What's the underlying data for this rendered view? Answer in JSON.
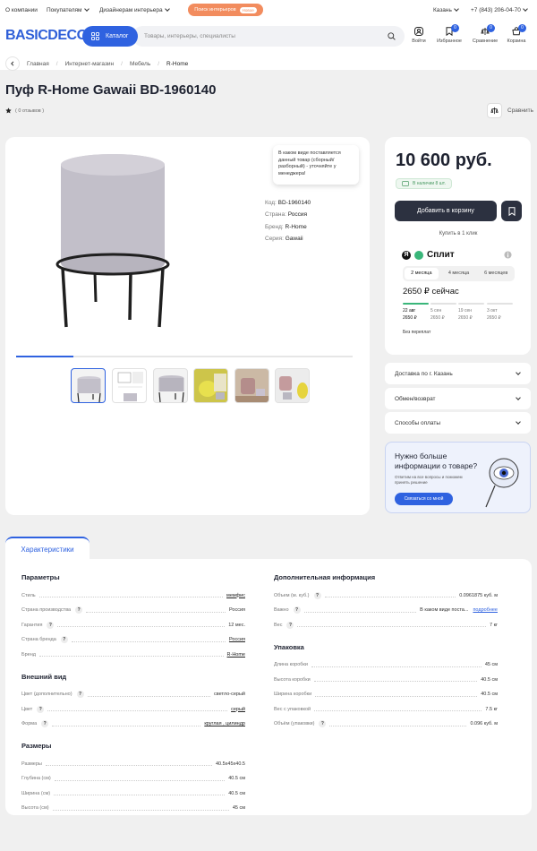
{
  "topbar": {
    "links": [
      "О компании",
      "Покупателям",
      "Дизайнерам интерьера"
    ],
    "promo_pill": {
      "label": "Поиск интерьеров",
      "badge": "Новое"
    },
    "city": "Казань",
    "phone": "+7 (843) 206-04-70"
  },
  "header": {
    "logo": "BASICDECOR",
    "catalog_label": "Каталог",
    "search_placeholder": "Товары, интерьеры, специалисты",
    "icons": [
      {
        "label": "Войти",
        "icon": "user-icon",
        "count": ""
      },
      {
        "label": "Избранное",
        "icon": "bookmark-icon",
        "count": "0"
      },
      {
        "label": "Сравнение",
        "icon": "compare-icon",
        "count": "0"
      },
      {
        "label": "Корзина",
        "icon": "cart-icon",
        "count": "0"
      }
    ]
  },
  "breadcrumbs": [
    "Главная",
    "Интернет-магазин",
    "Мебель",
    "R-Home"
  ],
  "product": {
    "title": "Пуф R-Home Gawaii BD-1960140",
    "rating_text": "( 0 отзывов )",
    "compare_label": "Сравнить",
    "tooltip": "В каком виде поставляется данный товар (сборный/разборный) - уточняйте у менеджера!",
    "specs": [
      {
        "label": "Код:",
        "value": "BD-1960140"
      },
      {
        "label": "Страна:",
        "value": "Россия"
      },
      {
        "label": "Бренд:",
        "value": "R-Home"
      },
      {
        "label": "Серия:",
        "value": "Gawaii"
      }
    ],
    "gallery_progress": 0.17
  },
  "buy": {
    "price": "10 600 руб.",
    "stock": "В наличии 8 шт.",
    "cart_button": "Добавить в корзину",
    "one_click": "Купить в 1 клик",
    "split": {
      "brand": "Сплит",
      "tabs": [
        "2 месяца",
        "4 месяца",
        "6 месяцев"
      ],
      "now": "2650 ₽ сейчас",
      "schedule": [
        {
          "date": "22 авг",
          "amount": "2650 ₽"
        },
        {
          "date": "5 сен",
          "amount": "2650 ₽"
        },
        {
          "date": "19 сен",
          "amount": "2650 ₽"
        },
        {
          "date": "3 окт",
          "amount": "2650 ₽"
        }
      ],
      "note": "Без переплат"
    },
    "accordions": [
      "Доставка по г. Казань",
      "Обмен/возврат",
      "Способы оплаты"
    ]
  },
  "promo": {
    "heading": "Нужно больше информации о товаре?",
    "sub": "Ответим на все вопросы и поможем принять решение",
    "button": "Связаться со мной"
  },
  "characteristics": {
    "tab": "Характеристики",
    "left": [
      {
        "title": "Параметры",
        "rows": [
          {
            "label": "Стиль",
            "value": "мемфис",
            "link": true,
            "help": false
          },
          {
            "label": "Страна производства",
            "value": "Россия",
            "link": false,
            "help": true
          },
          {
            "label": "Гарантия",
            "value": "12 мес.",
            "link": false,
            "help": true
          },
          {
            "label": "Страна бренда",
            "value": "Россия",
            "link": true,
            "help": true
          },
          {
            "label": "Бренд",
            "value": "R-Home",
            "link": true,
            "help": false
          }
        ]
      },
      {
        "title": "Внешний вид",
        "rows": [
          {
            "label": "Цвет (дополнительно)",
            "value": "светло-серый",
            "link": false,
            "help": true
          },
          {
            "label": "Цвет",
            "value": "серый",
            "link": true,
            "help": true
          },
          {
            "label": "Форма",
            "value": "круглая , цилиндр",
            "link": true,
            "help": true
          }
        ]
      },
      {
        "title": "Размеры",
        "rows": [
          {
            "label": "Размеры",
            "value": "40.5х45х40.5",
            "link": false,
            "help": false
          },
          {
            "label": "Глубина (см)",
            "value": "40.5 см",
            "link": false,
            "help": false
          },
          {
            "label": "Ширина (см)",
            "value": "40.5 см",
            "link": false,
            "help": false
          },
          {
            "label": "Высота (см)",
            "value": "45 см",
            "link": false,
            "help": false
          }
        ]
      }
    ],
    "right": [
      {
        "title": "Дополнительная информация",
        "rows": [
          {
            "label": "Объем (м. куб.)",
            "value": "0.0961875 куб. м",
            "link": false,
            "help": true
          },
          {
            "label": "Важно",
            "value": "В каком виде поста...",
            "extra": "подробнее",
            "link": false,
            "help": true
          },
          {
            "label": "Вес",
            "value": "7 кг",
            "link": false,
            "help": true
          }
        ]
      },
      {
        "title": "Упаковка",
        "rows": [
          {
            "label": "Длина коробки",
            "value": "45 см",
            "link": false,
            "help": false
          },
          {
            "label": "Высота коробки",
            "value": "40.5 см",
            "link": false,
            "help": false
          },
          {
            "label": "Ширина коробки",
            "value": "40.5 см",
            "link": false,
            "help": false
          },
          {
            "label": "Вес с упаковкой",
            "value": "7.5 кг",
            "link": false,
            "help": false
          },
          {
            "label": "Объём (упаковки)",
            "value": "0.096 куб. м",
            "link": false,
            "help": true
          }
        ]
      }
    ]
  },
  "colors": {
    "accent": "#2f62e0",
    "dark": "#2c3140",
    "promo_orange": "#f28c5e",
    "split_green": "#3ab67a"
  }
}
